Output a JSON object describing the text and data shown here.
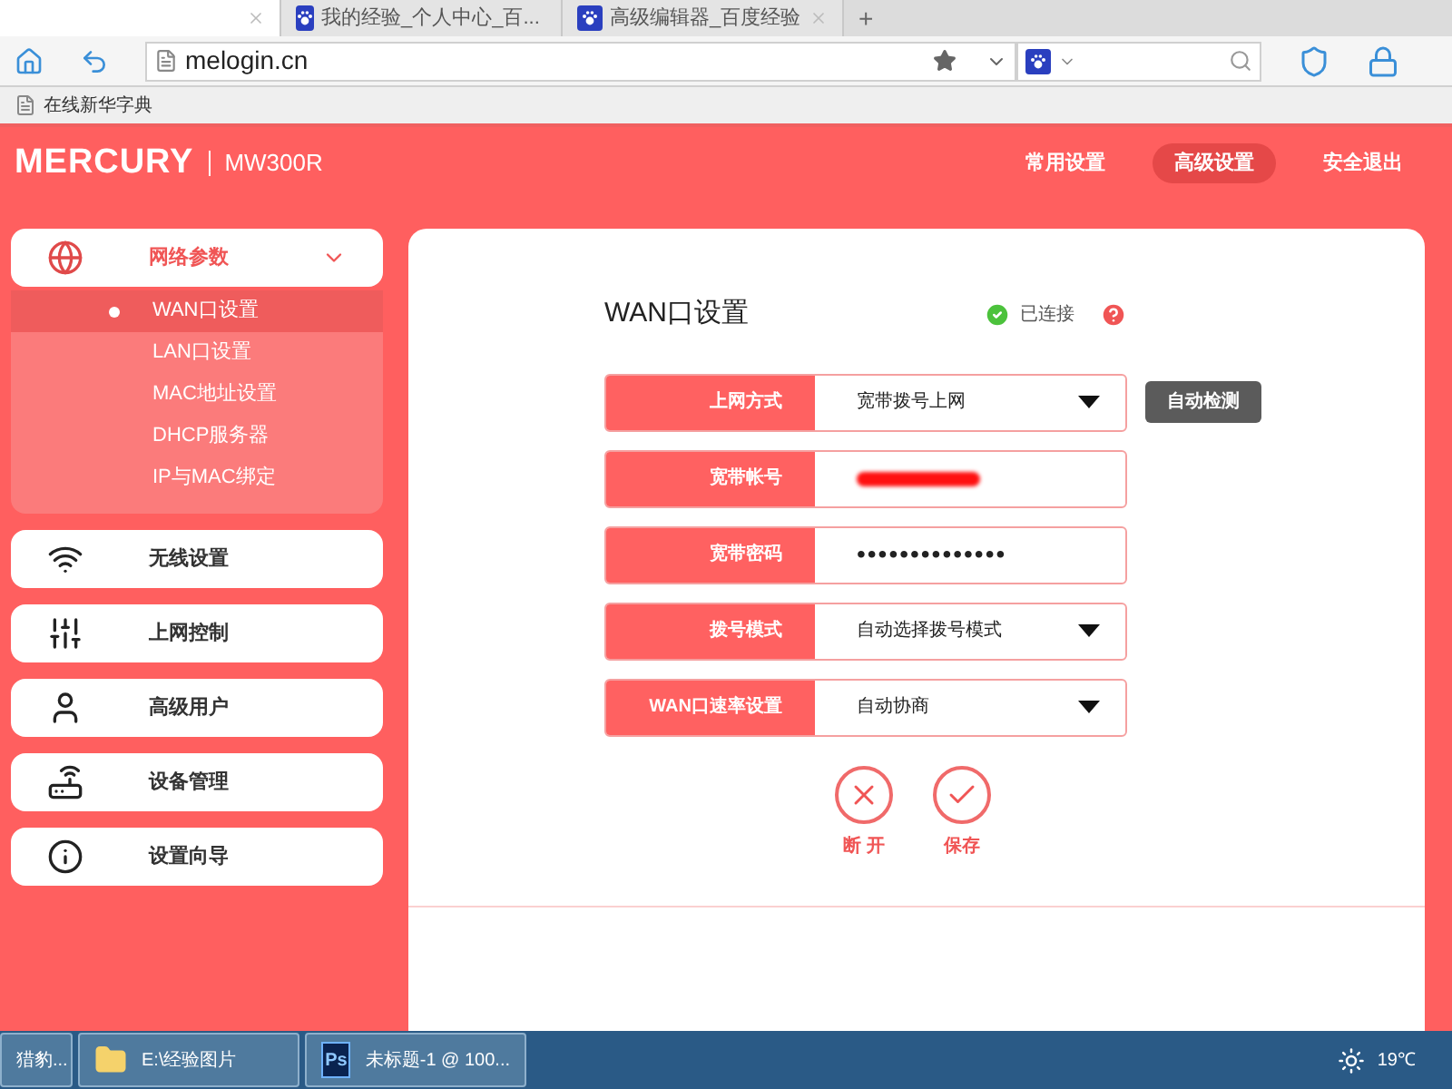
{
  "browser": {
    "tabs": [
      {
        "selected": true
      },
      {
        "label": "我的经验_个人中心_百...",
        "selected": false
      },
      {
        "label": "高级编辑器_百度经验",
        "selected": false
      }
    ],
    "new_tab": "+",
    "url": "melogin.cn",
    "bookmarks": [
      "在线新华字典"
    ]
  },
  "router": {
    "brand": "MERCURY",
    "model": "MW300R",
    "nav": [
      {
        "label": "常用设置",
        "selected": false
      },
      {
        "label": "高级设置",
        "selected": true
      },
      {
        "label": "安全退出",
        "selected": false
      }
    ],
    "sidebar": [
      {
        "label": "网络参数",
        "expanded": true,
        "children": [
          {
            "label": "WAN口设置",
            "selected": true
          },
          {
            "label": "LAN口设置",
            "selected": false
          },
          {
            "label": "MAC地址设置",
            "selected": false
          },
          {
            "label": "DHCP服务器",
            "selected": false
          },
          {
            "label": "IP与MAC绑定",
            "selected": false
          }
        ]
      },
      {
        "label": "无线设置",
        "expanded": false
      },
      {
        "label": "上网控制",
        "expanded": false
      },
      {
        "label": "高级用户",
        "expanded": false
      },
      {
        "label": "设备管理",
        "expanded": false
      },
      {
        "label": "设置向导",
        "expanded": false
      }
    ],
    "panel": {
      "title": "WAN口设置",
      "status": "已连接",
      "connected": true,
      "fields": [
        {
          "label": "上网方式",
          "kind": "select",
          "value": "宽带拨号上网"
        },
        {
          "label": "宽带帐号",
          "kind": "redacted"
        },
        {
          "label": "宽带密码",
          "kind": "password",
          "value": "••••••••••••••"
        },
        {
          "label": "拨号模式",
          "kind": "select",
          "value": "自动选择拨号模式"
        },
        {
          "label": "WAN口速率设置",
          "kind": "select",
          "value": "自动协商"
        }
      ],
      "detect_button": "自动检测",
      "actions": [
        {
          "label": "断 开",
          "kind": "disconnect"
        },
        {
          "label": "保存",
          "kind": "save"
        }
      ]
    }
  },
  "taskbar": {
    "items": [
      {
        "label": "猎豹...",
        "kind": "plain"
      },
      {
        "label": "E:\\经验图片",
        "kind": "folder"
      },
      {
        "label": "未标题-1 @ 100...",
        "kind": "ps",
        "icon_text": "Ps"
      }
    ],
    "temperature": "19℃"
  }
}
